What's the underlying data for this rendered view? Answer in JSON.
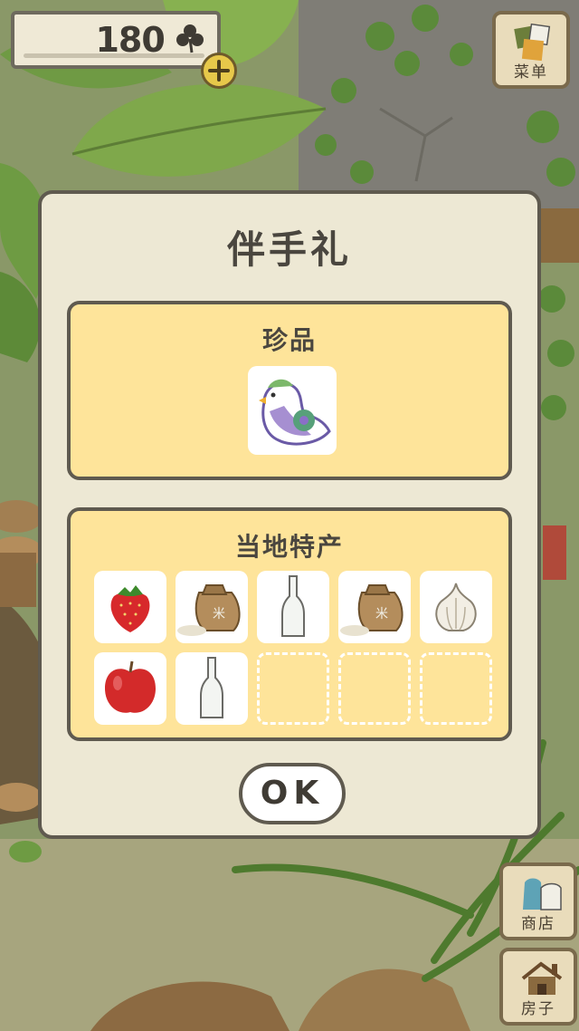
{
  "hud": {
    "clover_count": "180",
    "clover_icon": "clover-icon",
    "add_icon": "plus-icon"
  },
  "menu_button": {
    "label": "菜单",
    "icon": "menu-icon"
  },
  "shop_button": {
    "label": "商店",
    "icon": "shop-icon"
  },
  "house_button": {
    "label": "房子",
    "icon": "house-icon"
  },
  "dialog": {
    "title": "伴手礼",
    "rare": {
      "title": "珍品",
      "items": [
        {
          "icon": "pigeon-whistle-icon"
        }
      ]
    },
    "local": {
      "title": "当地特产",
      "items": [
        {
          "icon": "strawberry-icon"
        },
        {
          "icon": "rice-bag-icon"
        },
        {
          "icon": "empty-bottle-icon"
        },
        {
          "icon": "rice-bag-icon"
        },
        {
          "icon": "garlic-icon"
        },
        {
          "icon": "apple-icon"
        },
        {
          "icon": "empty-bottle-icon"
        },
        {
          "icon": "empty-slot"
        },
        {
          "icon": "empty-slot"
        },
        {
          "icon": "empty-slot"
        }
      ]
    },
    "ok_label": "OK"
  },
  "colors": {
    "panel": "#fee49a",
    "dialog": "#ede8d4",
    "border": "#5f5a4f"
  }
}
